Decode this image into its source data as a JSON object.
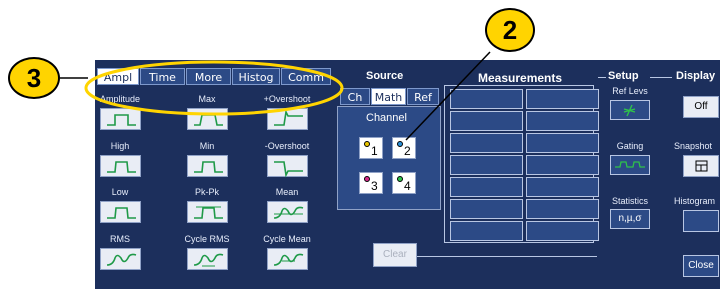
{
  "tabs": [
    {
      "label": "Ampl"
    },
    {
      "label": "Time"
    },
    {
      "label": "More"
    },
    {
      "label": "Histog"
    },
    {
      "label": "Comm"
    }
  ],
  "measurements": [
    {
      "label": "Amplitude",
      "icon": "amplitude-wave-icon"
    },
    {
      "label": "Max",
      "icon": "max-wave-icon"
    },
    {
      "label": "+Overshoot",
      "icon": "positive-overshoot-icon"
    },
    {
      "label": "High",
      "icon": "high-wave-icon"
    },
    {
      "label": "Min",
      "icon": "min-wave-icon"
    },
    {
      "label": "-Overshoot",
      "icon": "negative-overshoot-icon"
    },
    {
      "label": "Low",
      "icon": "low-wave-icon"
    },
    {
      "label": "Pk-Pk",
      "icon": "peak-to-peak-icon"
    },
    {
      "label": "Mean",
      "icon": "mean-wave-icon"
    },
    {
      "label": "RMS",
      "icon": "rms-wave-icon"
    },
    {
      "label": "Cycle RMS",
      "icon": "cycle-rms-icon"
    },
    {
      "label": "Cycle Mean",
      "icon": "cycle-mean-icon"
    }
  ],
  "source": {
    "title": "Source",
    "tabs": [
      {
        "label": "Ch"
      },
      {
        "label": "Math"
      },
      {
        "label": "Ref"
      }
    ],
    "channel_label": "Channel",
    "channels": [
      {
        "num": "1"
      },
      {
        "num": "2"
      },
      {
        "num": "3"
      },
      {
        "num": "4"
      }
    ],
    "channel_colors": [
      "#e8c400",
      "#2a8fd6",
      "#d42a8a",
      "#2ec24a"
    ]
  },
  "measurements_panel": {
    "title": "Measurements",
    "clear_label": "Clear"
  },
  "setup": {
    "title": "Setup",
    "ref_levs": "Ref Levs",
    "gating": "Gating",
    "statistics": "Statistics",
    "stats_value": "n,µ,σ"
  },
  "display": {
    "title": "Display",
    "off_label": "Off",
    "snapshot": "Snapshot",
    "histogram": "Histogram",
    "close_label": "Close"
  },
  "callouts": {
    "left": "3",
    "top": "2"
  },
  "colors": {
    "panel": "#1c2f5c",
    "cell": "#2c4a86",
    "callout": "#ffd400",
    "wave": "#1f9a48"
  }
}
